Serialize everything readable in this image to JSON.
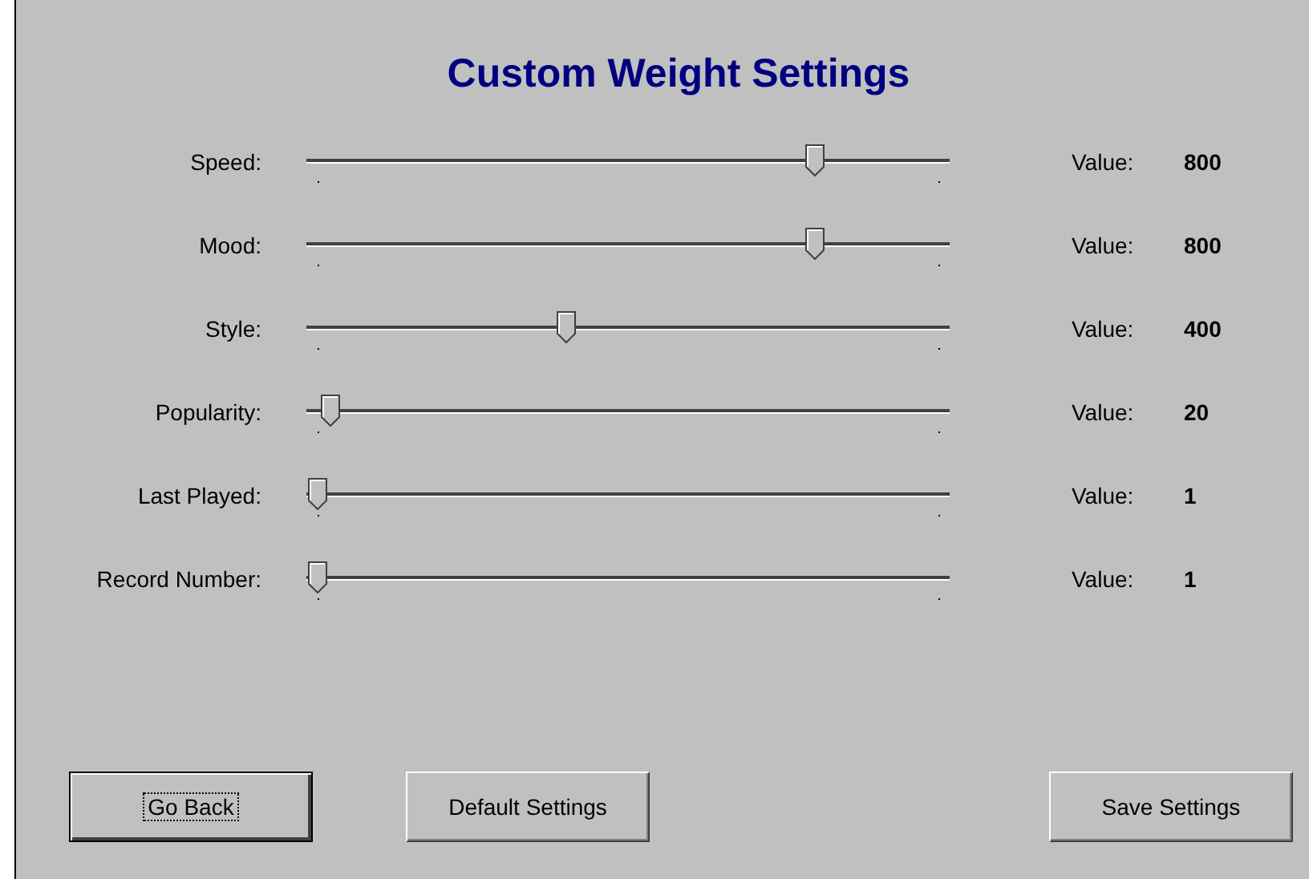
{
  "title": "Custom Weight Settings",
  "sliders": [
    {
      "label": "Speed:",
      "level": 0.8,
      "value_label": "Value:",
      "value": "800"
    },
    {
      "label": "Mood:",
      "level": 0.8,
      "value_label": "Value:",
      "value": "800"
    },
    {
      "label": "Style:",
      "level": 0.4,
      "value_label": "Value:",
      "value": "400"
    },
    {
      "label": "Popularity:",
      "level": 0.02,
      "value_label": "Value:",
      "value": "20"
    },
    {
      "label": "Last Played:",
      "level": 0,
      "value_label": "Value:",
      "value": "1"
    },
    {
      "label": "Record Number:",
      "level": 0,
      "value_label": "Value:",
      "value": "1"
    }
  ],
  "buttons": [
    {
      "label": "Go Back",
      "focused": true
    },
    {
      "label": "Default Settings",
      "focused": false
    },
    {
      "label": "Save Settings",
      "focused": false
    }
  ]
}
